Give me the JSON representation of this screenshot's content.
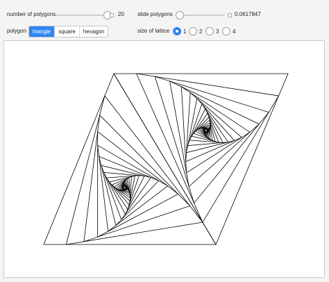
{
  "controls": {
    "num_polygons": {
      "label": "number of polygons",
      "value": "20",
      "fraction": 0.95
    },
    "slide_polygons": {
      "label": "slide polygons",
      "value": "0.0617847",
      "fraction": 0.06
    },
    "polygon": {
      "label": "polygon",
      "options": [
        "triangle",
        "square",
        "hexagon"
      ],
      "selected": "triangle"
    },
    "lattice_size": {
      "label": "size of lattice",
      "options": [
        "1",
        "2",
        "3",
        "4"
      ],
      "selected": "1"
    }
  },
  "figure": {
    "shape": "triangle",
    "nested_count": 20,
    "slide": 0.0617847,
    "stroke_color": "#000000"
  }
}
